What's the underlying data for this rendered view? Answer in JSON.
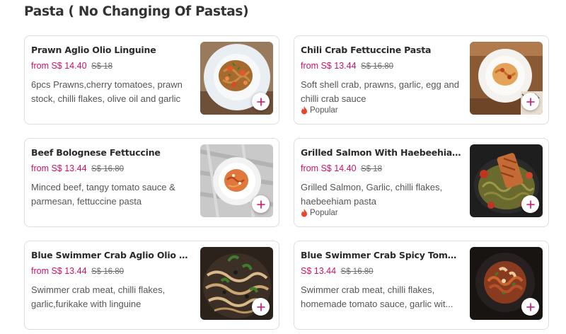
{
  "section": {
    "title": "Pasta",
    "subtitle": "( No Changing Of Pastas)"
  },
  "items": [
    {
      "name": "Prawn Aglio Olio Linguine",
      "price": "from S$ 14.40",
      "old_price": "S$ 18",
      "desc_lines": [
        "6pcs Prawns,cherry tomatoes, prawn",
        "stock, chilli flakes, olive oil and garlic"
      ],
      "popular": ""
    },
    {
      "name": "Chili Crab Fettuccine Pasta",
      "price": "from S$ 13.44",
      "old_price": "S$ 16.80",
      "desc_lines": [
        "Soft shell crab, prawns, garlic, egg and",
        "chilli crab sauce"
      ],
      "popular": "Popular"
    },
    {
      "name": "Beef Bolognese Fettuccine",
      "price": "from S$ 13.44",
      "old_price": "S$ 16.80",
      "desc_lines": [
        "Minced beef, tangy tomato sauce &",
        "parmesan, fettuccine pasta"
      ],
      "popular": ""
    },
    {
      "name": "Grilled Salmon With Haebeehiam Li...",
      "price": "from S$ 14.40",
      "old_price": "S$ 18",
      "desc_lines": [
        "Grilled Salmon, Garlic, chilli flakes,",
        "haebeehiam pasta"
      ],
      "popular": "Popular"
    },
    {
      "name": "Blue Swimmer Crab Aglio Olio Ling...",
      "price": "from S$ 13.44",
      "old_price": "S$ 16.80",
      "desc_lines": [
        "Swimmer crab meat, chilli flakes,",
        "garlic,furikake with linguine"
      ],
      "popular": ""
    },
    {
      "name": "Blue Swimmer Crab Spicy Tomato ...",
      "price": "S$ 13.44",
      "old_price": "S$ 16.80",
      "desc_lines": [
        "Swimmer crab meat, chilli flakes,",
        "homemade tomato sauce, garlic wit..."
      ],
      "popular": ""
    }
  ],
  "icons": {
    "add": "plus-icon",
    "popular": "flame-icon",
    "photo": "dish-photo"
  },
  "colors": {
    "accent": "#d70f64",
    "popular_flame": "#e8462b"
  }
}
